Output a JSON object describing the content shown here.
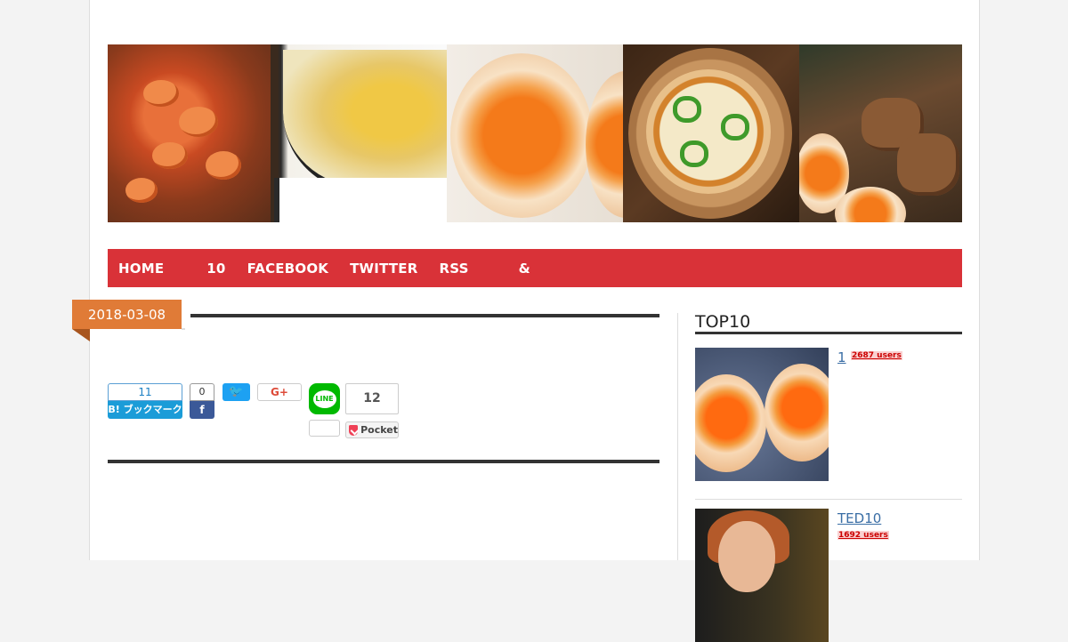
{
  "nav": {
    "items": [
      "HOME",
      "10",
      "FACEBOOK",
      "TWITTER",
      "RSS",
      "&"
    ]
  },
  "post": {
    "date": "2018-03-08"
  },
  "share": {
    "hatena_count": "11",
    "hatena_label": "B! ブックマーク",
    "facebook_count": "0",
    "facebook_label": "f",
    "twitter_label": "🐦",
    "google_label": "G+",
    "line_label": "LINE",
    "pocket_count": "12",
    "pocket_label": "Pocket"
  },
  "sidebar": {
    "title": "TOP10",
    "ranking": [
      {
        "title": "1",
        "users": "2687 users"
      },
      {
        "title": "TED10",
        "users": "1692 users"
      }
    ]
  },
  "colors": {
    "nav_bg": "#d93238",
    "date_badge": "#e07b37",
    "hatena": "#1b9cd8",
    "facebook": "#3b5998",
    "twitter": "#1da1f2",
    "line": "#00b900",
    "pocket": "#ef4056"
  }
}
